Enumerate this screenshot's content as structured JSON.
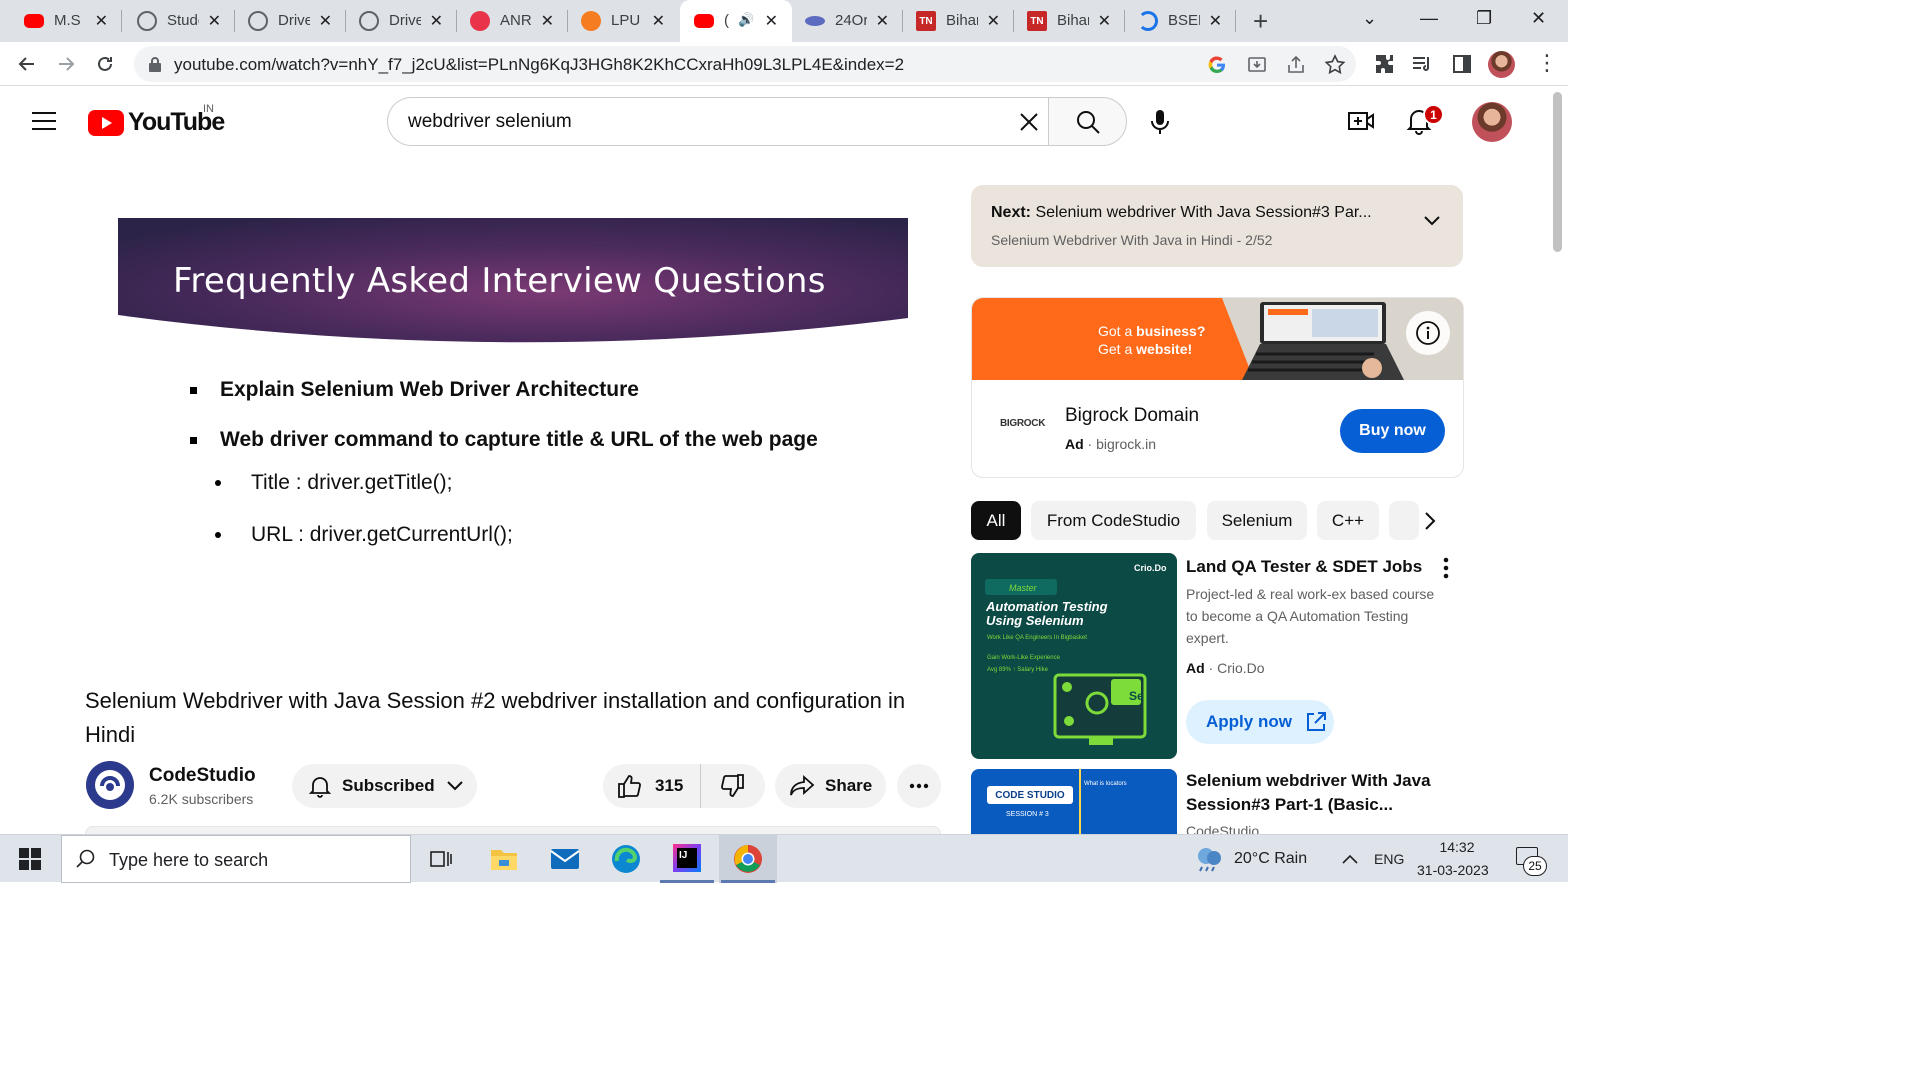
{
  "browser": {
    "tabs": [
      {
        "title": "M.S F",
        "favicon": "youtube-icon",
        "color": "#ff0000"
      },
      {
        "title": "Stude",
        "favicon": "globe-icon",
        "color": "#5f6368"
      },
      {
        "title": "Drive",
        "favicon": "globe-icon",
        "color": "#5f6368"
      },
      {
        "title": "Drive",
        "favicon": "globe-icon",
        "color": "#5f6368"
      },
      {
        "title": "ANR",
        "favicon": "anr-icon",
        "color": "#e8334a"
      },
      {
        "title": "LPU I",
        "favicon": "lpu-icon",
        "color": "#f57c20"
      },
      {
        "title": "(",
        "favicon": "youtube-icon",
        "color": "#ff0000",
        "active": true
      },
      {
        "title": "24Or",
        "favicon": "cloud-icon",
        "color": "#5c6bc0"
      },
      {
        "title": "Bihar",
        "favicon": "tn-icon",
        "color": "#c62828"
      },
      {
        "title": "Bihar",
        "favicon": "tn-icon",
        "color": "#c62828"
      },
      {
        "title": "BSEB",
        "favicon": "loading-icon",
        "color": "#1a73e8"
      }
    ],
    "url": "youtube.com/watch?v=nhY_f7_j2cU&list=PLnNg6KqJ3HGh8K2KhCCxraHh09L3LPL4E&index=2"
  },
  "youtube": {
    "logo_text": "YouTube",
    "country_code": "IN",
    "search_value": "webdriver selenium",
    "notification_count": "1"
  },
  "slide": {
    "banner_title": "Frequently Asked Interview Questions",
    "bullet1": "Explain Selenium Web Driver Architecture",
    "bullet2": "Web driver command to capture title & URL of the web page",
    "sub1": "Title : driver.getTitle();",
    "sub2": "URL : driver.getCurrentUrl();"
  },
  "video": {
    "title": "Selenium Webdriver with Java Session #2 webdriver installation and configuration in Hindi",
    "channel_name": "CodeStudio",
    "subscribers": "6.2K subscribers",
    "subscribe_label": "Subscribed",
    "likes": "315",
    "share_label": "Share"
  },
  "sidebar": {
    "next_prefix": "Next:",
    "next_title": "Selenium webdriver With Java Session#3 Par...",
    "next_playlist": "Selenium Webdriver With Java in Hindi - 2/52",
    "ad": {
      "banner_line1a": "Got a ",
      "banner_line1b": "business?",
      "banner_line2a": "Get a ",
      "banner_line2b": "website!",
      "logo_text": "BIGROCK",
      "name": "Bigrock Domain",
      "ad_label": "Ad",
      "domain": "bigrock.in",
      "cta": "Buy now"
    },
    "chips": [
      "All",
      "From CodeStudio",
      "Selenium",
      "C++"
    ],
    "rec_ad": {
      "title": "Land QA Tester & SDET Jobs",
      "description": "Project-led & real work-ex based course to become a QA Automation Testing expert.",
      "ad_label": "Ad",
      "advertiser": "Crio.Do",
      "cta": "Apply now",
      "thumb_brand": "Crio.Do",
      "thumb_kicker": "Master",
      "thumb_heading1": "Automation Testing",
      "thumb_heading2": "Using Selenium",
      "thumb_point1": "Work Like QA Engineers In Bigbasket",
      "thumb_point2": "Gain Work-Like Experience",
      "thumb_point3": "Avg 89% ↑ Salary Hike"
    },
    "rec_video": {
      "title": "Selenium webdriver With Java Session#3 Part-1 (Basic...",
      "channel": "CodeStudio",
      "thumb_label": "CODE STUDIO",
      "thumb_session": "SESSION # 3",
      "thumb_topic": "What is locators"
    }
  },
  "taskbar": {
    "search_placeholder": "Type here to search",
    "weather": "20°C  Rain",
    "language": "ENG",
    "time": "14:32",
    "date": "31-03-2023",
    "notifications": "25"
  }
}
